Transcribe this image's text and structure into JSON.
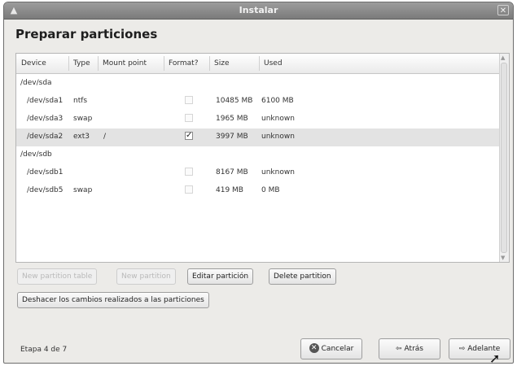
{
  "window": {
    "title": "Instalar"
  },
  "page": {
    "heading": "Preparar particiones"
  },
  "table": {
    "headers": [
      "Device",
      "Type",
      "Mount point",
      "Format?",
      "Size",
      "Used"
    ],
    "rows": [
      {
        "device": "/dev/sda",
        "type": "",
        "mount": "",
        "format": null,
        "size": "",
        "used": "",
        "group": true
      },
      {
        "device": "/dev/sda1",
        "type": "ntfs",
        "mount": "",
        "format": false,
        "size": "10485 MB",
        "used": "6100 MB"
      },
      {
        "device": "/dev/sda3",
        "type": "swap",
        "mount": "",
        "format": false,
        "size": "1965 MB",
        "used": "unknown"
      },
      {
        "device": "/dev/sda2",
        "type": "ext3",
        "mount": "/",
        "format": true,
        "size": "3997 MB",
        "used": "unknown",
        "selected": true
      },
      {
        "device": "/dev/sdb",
        "type": "",
        "mount": "",
        "format": null,
        "size": "",
        "used": "",
        "group": true
      },
      {
        "device": "/dev/sdb1",
        "type": "",
        "mount": "",
        "format": false,
        "size": "8167 MB",
        "used": "unknown"
      },
      {
        "device": "/dev/sdb5",
        "type": "swap",
        "mount": "",
        "format": false,
        "size": "419 MB",
        "used": "0 MB"
      }
    ]
  },
  "buttons": {
    "new_partition_table": "New partition table",
    "new_partition": "New partition",
    "edit_partition": "Editar partición",
    "delete_partition": "Delete partition",
    "undo_changes": "Deshacer los cambios realizados a las particiones"
  },
  "footer": {
    "step": "Etapa 4 de 7",
    "cancel": "Cancelar",
    "back": "Atrás",
    "forward": "Adelante"
  }
}
